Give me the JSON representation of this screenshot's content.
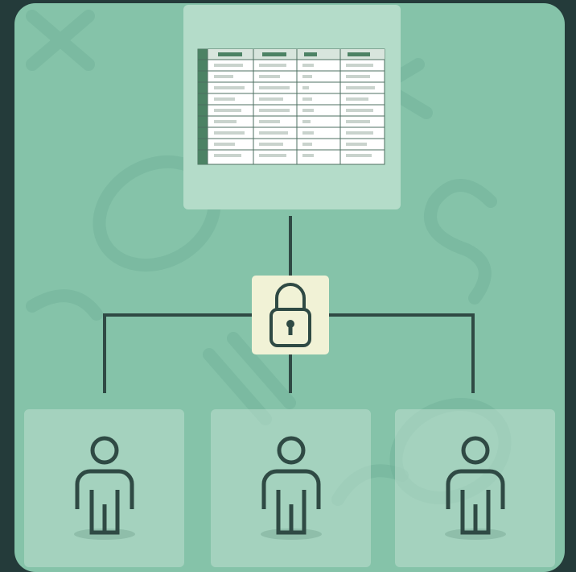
{
  "colors": {
    "background": "#243b3a",
    "board": "#85c3a9",
    "panel": "#b4dcc9",
    "line": "#2f4a44",
    "lock_box": "#f1f2d6",
    "table_header": "#4c8264"
  },
  "icons": [
    "spreadsheet-icon",
    "padlock-icon",
    "person-icon"
  ],
  "table": {
    "columns": 4,
    "rows": 9
  },
  "watermark_text": "SOLEX"
}
